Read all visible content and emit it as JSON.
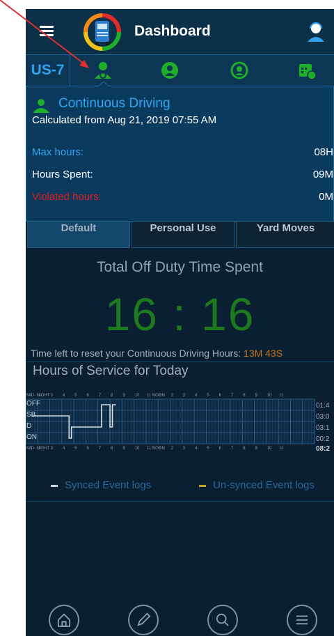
{
  "header": {
    "title": "Dashboard"
  },
  "tabs": {
    "label": "US-7"
  },
  "panel": {
    "title": "Continuous Driving",
    "subtitle": "Calculated from Aug 21, 2019 07:55 AM",
    "rows": [
      {
        "label": "Max hours:",
        "value": "08H",
        "color": "#33a6ef"
      },
      {
        "label": "Hours Spent:",
        "value": "09M",
        "color": "#ffffff"
      },
      {
        "label": "Violated hours:",
        "value": "0M",
        "color": "#e31d1d"
      }
    ]
  },
  "modes": [
    "Default",
    "Personal Use",
    "Yard Moves"
  ],
  "offduty": {
    "title": "Total Off Duty Time Spent",
    "clock": "16 : 16"
  },
  "reset": {
    "label": "Time left to reset your Continuous Driving Hours:",
    "value": "13M 43S"
  },
  "hos": {
    "title": "Hours of Service for Today",
    "hour_labels": [
      "MID- NIGHT",
      "2",
      "3",
      "4",
      "5",
      "6",
      "7",
      "8",
      "9",
      "10",
      "11 NOON",
      "1",
      "2",
      "3",
      "4",
      "5",
      "6",
      "7",
      "8",
      "9",
      "10",
      "11"
    ],
    "status_labels": [
      "OFF",
      "SB",
      "D",
      "ON"
    ],
    "totals": [
      "01:4",
      "03:0",
      "03:1",
      "00:2"
    ],
    "current_time": "08:2"
  },
  "legend": {
    "synced": "Synced Event logs",
    "unsynced": "Un-synced Event logs"
  },
  "colors": {
    "accent": "#2fa3f0",
    "driving_green": "#1fae2a",
    "violation": "#e31d1d",
    "clock": "#1e7a1e",
    "unsynced": "#c8a21c"
  }
}
